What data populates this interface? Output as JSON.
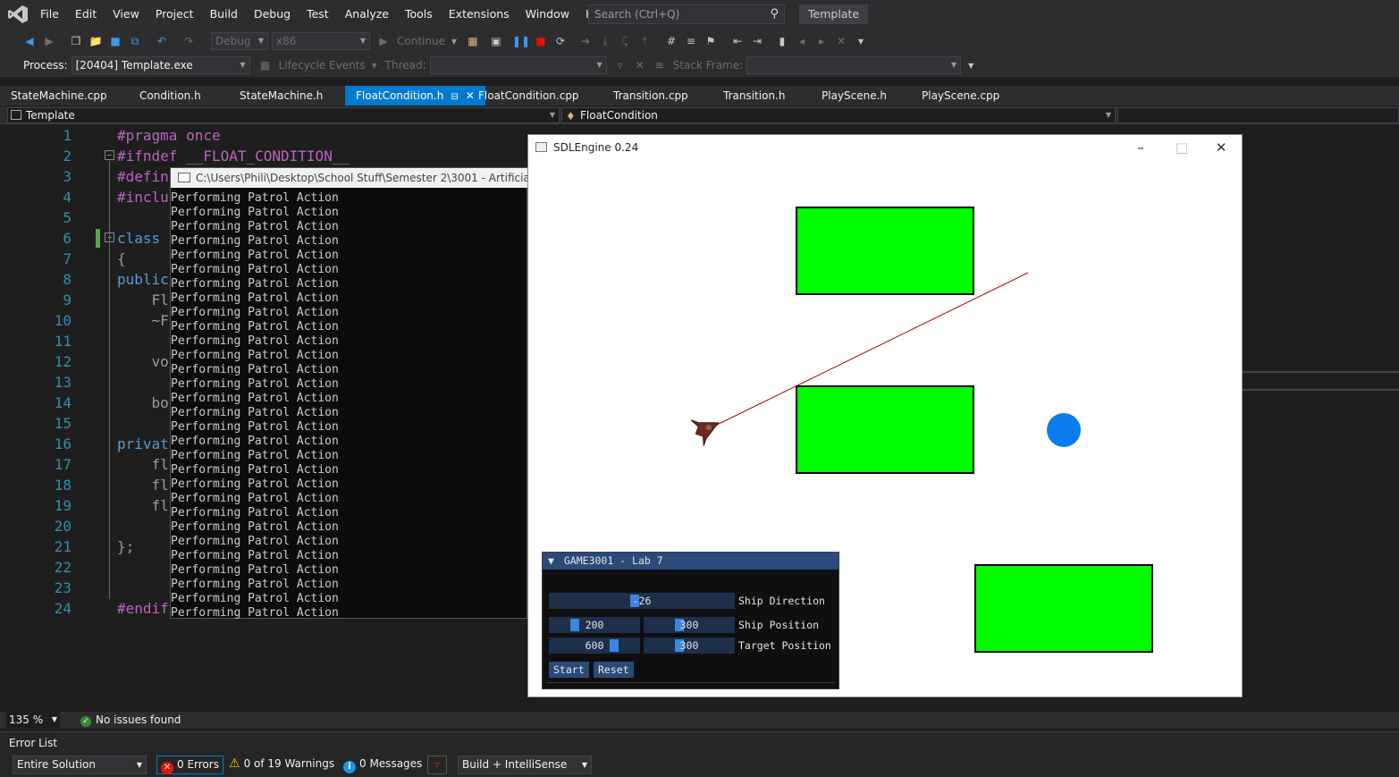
{
  "menubar": {
    "items": [
      "File",
      "Edit",
      "View",
      "Project",
      "Build",
      "Debug",
      "Test",
      "Analyze",
      "Tools",
      "Extensions",
      "Window",
      "Help"
    ],
    "search_placeholder": "Search (Ctrl+Q)",
    "solution_name": "Template"
  },
  "toolbar": {
    "configuration": "Debug",
    "platform": "x86",
    "continue_label": "Continue",
    "process_label": "Process:",
    "process_value": "[20404] Template.exe",
    "lifecycle_label": "Lifecycle Events",
    "thread_label": "Thread:",
    "stack_frame_label": "Stack Frame:"
  },
  "tabs": [
    {
      "label": "StateMachine.cpp",
      "active": false
    },
    {
      "label": "Condition.h",
      "active": false
    },
    {
      "label": "StateMachine.h",
      "active": false
    },
    {
      "label": "FloatCondition.h",
      "active": true
    },
    {
      "label": "FloatCondition.cpp",
      "active": false
    },
    {
      "label": "Transition.cpp",
      "active": false
    },
    {
      "label": "Transition.h",
      "active": false
    },
    {
      "label": "PlayScene.h",
      "active": false
    },
    {
      "label": "PlayScene.cpp",
      "active": false
    }
  ],
  "navbar": {
    "project": "Template",
    "scope": "FloatCondition"
  },
  "editor": {
    "line_numbers": [
      "1",
      "2",
      "3",
      "4",
      "5",
      "6",
      "7",
      "8",
      "9",
      "10",
      "11",
      "12",
      "13",
      "14",
      "15",
      "16",
      "17",
      "18",
      "19",
      "20",
      "21",
      "22",
      "23",
      "24"
    ],
    "lines": [
      {
        "kind": "macro",
        "text": "#pragma once"
      },
      {
        "kind": "macro",
        "text": "#ifndef __FLOAT_CONDITION__"
      },
      {
        "kind": "macro",
        "text": "#defin"
      },
      {
        "kind": "macro",
        "text": "#inclu"
      },
      {
        "kind": "plain",
        "text": ""
      },
      {
        "kind": "kw",
        "text": "class "
      },
      {
        "kind": "plain",
        "text": "{"
      },
      {
        "kind": "kw",
        "text": "public"
      },
      {
        "kind": "plain",
        "text": "    Fl"
      },
      {
        "kind": "plain",
        "text": "    ~F"
      },
      {
        "kind": "plain",
        "text": ""
      },
      {
        "kind": "plain",
        "text": "    vo"
      },
      {
        "kind": "plain",
        "text": ""
      },
      {
        "kind": "plain",
        "text": "    bo"
      },
      {
        "kind": "plain",
        "text": ""
      },
      {
        "kind": "kw",
        "text": "privat"
      },
      {
        "kind": "plain",
        "text": "    fl"
      },
      {
        "kind": "plain",
        "text": "    fl"
      },
      {
        "kind": "plain",
        "text": "    fl"
      },
      {
        "kind": "plain",
        "text": ""
      },
      {
        "kind": "plain",
        "text": "};"
      },
      {
        "kind": "plain",
        "text": ""
      },
      {
        "kind": "plain",
        "text": ""
      },
      {
        "kind": "macro",
        "text": "#endif"
      }
    ]
  },
  "console": {
    "title": "C:\\Users\\Phili\\Desktop\\School Stuff\\Semester 2\\3001 - Artificial Intelle",
    "lines": [
      "Performing Patrol Action",
      "Performing Patrol Action",
      "Performing Patrol Action",
      "Performing Patrol Action",
      "Performing Patrol Action",
      "Performing Patrol Action",
      "Performing Patrol Action",
      "Performing Patrol Action",
      "Performing Patrol Action",
      "Performing Patrol Action",
      "Performing Patrol Action",
      "Performing Patrol Action",
      "Performing Patrol Action",
      "Performing Patrol Action",
      "Performing Patrol Action",
      "Performing Patrol Action",
      "Performing Patrol Action",
      "Performing Patrol Action",
      "Performing Patrol Action",
      "Performing Patrol Action",
      "Performing Patrol Action",
      "Performing Patrol Action",
      "Performing Patrol Action",
      "Performing Patrol Action",
      "Performing Patrol Action",
      "Performing Patrol Action",
      "Performing Patrol Action",
      "Performing Patrol Action",
      "Performing Patrol Action",
      "Performing Patrol Action"
    ]
  },
  "sdl_window": {
    "title": "SDLEngine 0.24",
    "minimize": "–",
    "maximize": "□",
    "close": "✕",
    "obstacle_color": "#00ff00",
    "target_color": "#0a7cf0",
    "los_color": "#b00000"
  },
  "imgui": {
    "title": "GAME3001 - Lab 7",
    "ship_direction_value": "-26",
    "ship_direction_label": "Ship Direction",
    "ship_x": "200",
    "ship_y": "300",
    "ship_position_label": "Ship Position",
    "target_x": "600",
    "target_y": "300",
    "target_position_label": "Target Position",
    "start_label": "Start",
    "reset_label": "Reset"
  },
  "status": {
    "zoom": "135 %",
    "issues": "No issues found"
  },
  "error_list": {
    "title": "Error List",
    "scope": "Entire Solution",
    "errors": "0 Errors",
    "warnings": "0 of 19 Warnings",
    "messages": "0 Messages",
    "build_filter": "Build + IntelliSense"
  }
}
